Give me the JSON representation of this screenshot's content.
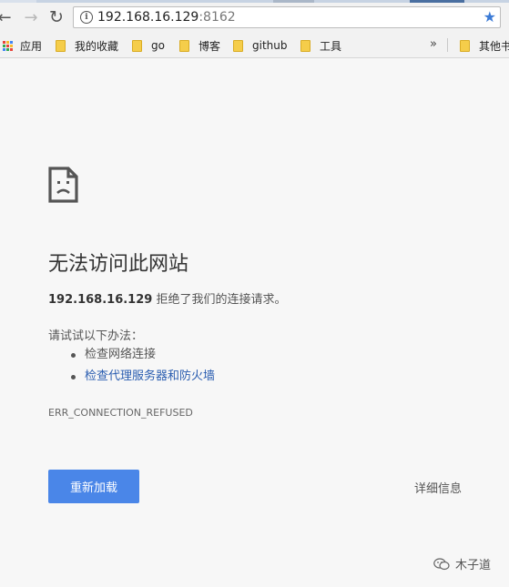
{
  "browser": {
    "url_host": "192.168.16.129",
    "url_port": ":8162",
    "icons": {
      "back": "back-arrow-icon",
      "forward": "forward-arrow-icon",
      "reload": "reload-icon",
      "info": "info-icon",
      "star": "star-icon"
    }
  },
  "bookmarks": {
    "apps_label": "应用",
    "items": [
      {
        "label": "我的收藏"
      },
      {
        "label": "go"
      },
      {
        "label": "博客"
      },
      {
        "label": "github"
      },
      {
        "label": "工具"
      }
    ],
    "more_label": "»",
    "other_label": "其他书"
  },
  "error_page": {
    "icon": "sad-page-icon",
    "heading": "无法访问此网站",
    "summary_host": "192.168.16.129",
    "summary_text": " 拒绝了我们的连接请求。",
    "suggestions_title": "请试试以下办法：",
    "suggestions": [
      {
        "label": "检查网络连接",
        "is_link": false
      },
      {
        "label": "检查代理服务器和防火墙",
        "is_link": true
      }
    ],
    "error_code": "ERR_CONNECTION_REFUSED",
    "reload_button": "重新加载",
    "details_button": "详细信息"
  },
  "watermark": {
    "text": "木子道",
    "icon": "wechat-logo-icon"
  },
  "colors": {
    "accent_button": "#4a86e8",
    "link": "#2a5db0",
    "star": "#3c7bd6",
    "folder": "#f5cd4a"
  }
}
